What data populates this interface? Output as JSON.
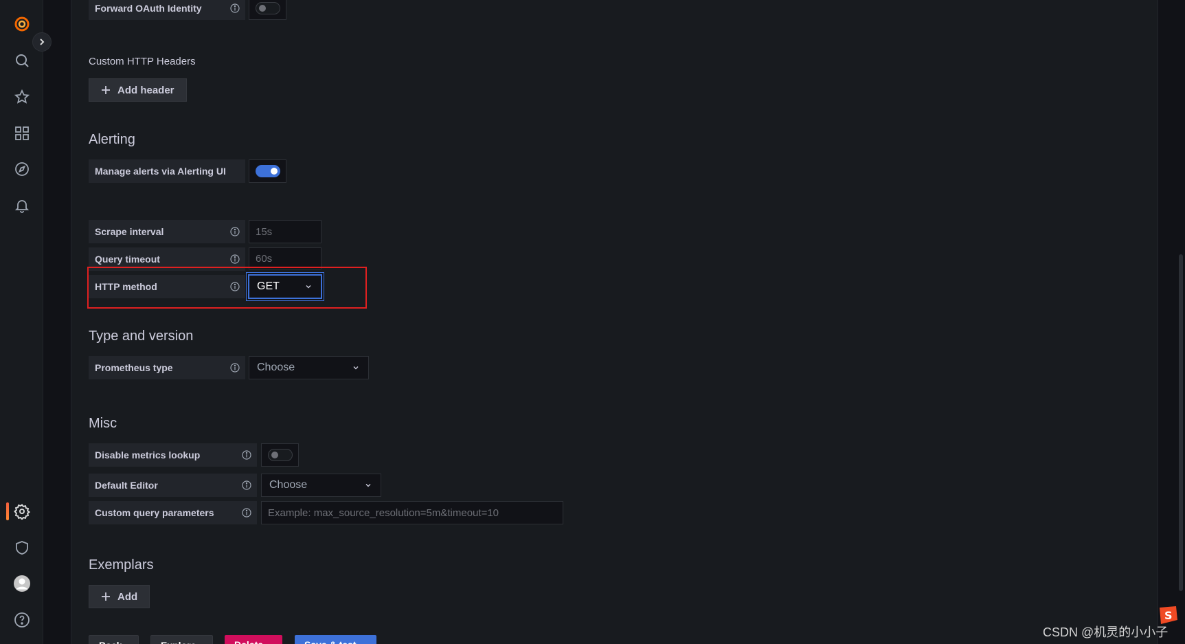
{
  "sidebar": {
    "icons": [
      "grafana-logo-icon",
      "search-icon",
      "star-icon",
      "dashboards-icon",
      "explore-icon",
      "bell-icon",
      "gear-icon",
      "shield-icon",
      "avatar",
      "help-icon"
    ]
  },
  "auth": {
    "forward_oauth_label": "Forward OAuth Identity"
  },
  "headers": {
    "title": "Custom HTTP Headers",
    "add_header_label": "Add header"
  },
  "alerting": {
    "title": "Alerting",
    "manage_alerts_label": "Manage alerts via Alerting UI",
    "scrape_interval_label": "Scrape interval",
    "scrape_interval_placeholder": "15s",
    "query_timeout_label": "Query timeout",
    "query_timeout_placeholder": "60s",
    "http_method_label": "HTTP method",
    "http_method_value": "GET"
  },
  "type_version": {
    "title": "Type and version",
    "prometheus_type_label": "Prometheus type",
    "prometheus_type_value": "Choose"
  },
  "misc": {
    "title": "Misc",
    "disable_metrics_label": "Disable metrics lookup",
    "default_editor_label": "Default Editor",
    "default_editor_value": "Choose",
    "custom_query_label": "Custom query parameters",
    "custom_query_placeholder": "Example: max_source_resolution=5m&timeout=10"
  },
  "exemplars": {
    "title": "Exemplars",
    "add_label": "Add"
  },
  "footer_buttons": [
    "Back",
    "Explore",
    "Delete",
    "Save & test"
  ],
  "watermark": "CSDN @机灵的小小子",
  "colors": {
    "accent": "#3d71d9",
    "danger": "#d10e5c",
    "highlight": "#e02020"
  }
}
